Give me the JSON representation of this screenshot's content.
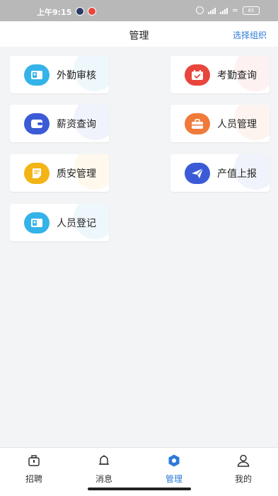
{
  "status_bar": {
    "time": "上午9:15",
    "battery": "85"
  },
  "header": {
    "title": "管理",
    "action": "选择组织"
  },
  "menu": [
    {
      "label": "外勤审核",
      "icon": "id-card-icon",
      "color": "#34b3e8"
    },
    {
      "label": "考勤查询",
      "icon": "calendar-check-icon",
      "color": "#e8453c"
    },
    {
      "label": "薪资查询",
      "icon": "wallet-icon",
      "color": "#3b5bd6"
    },
    {
      "label": "人员管理",
      "icon": "briefcase-icon",
      "color": "#f07a3a"
    },
    {
      "label": "质安管理",
      "icon": "document-icon",
      "color": "#f2b417"
    },
    {
      "label": "产值上报",
      "icon": "paper-plane-icon",
      "color": "#3b5bd6"
    },
    {
      "label": "人员登记",
      "icon": "id-card-icon",
      "color": "#34b3e8"
    }
  ],
  "bottom_nav": [
    {
      "label": "招聘",
      "icon": "briefcase-icon",
      "active": false
    },
    {
      "label": "消息",
      "icon": "bell-icon",
      "active": false
    },
    {
      "label": "管理",
      "icon": "hexagon-icon",
      "active": true
    },
    {
      "label": "我的",
      "icon": "user-icon",
      "active": false
    }
  ],
  "colors": {
    "accent": "#2e7bd6",
    "background": "#f3f4f6"
  }
}
